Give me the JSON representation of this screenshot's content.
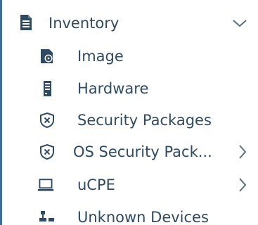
{
  "nav": {
    "header": {
      "label": "Inventory",
      "icon": "document-icon",
      "expanded": true
    },
    "items": [
      {
        "label": "Image",
        "icon": "disk-image-icon",
        "has_submenu": false
      },
      {
        "label": "Hardware",
        "icon": "server-tower-icon",
        "has_submenu": false
      },
      {
        "label": "Security Packages",
        "icon": "shield-x-icon",
        "has_submenu": false
      },
      {
        "label": "OS Security Pack...",
        "icon": "shield-x-icon",
        "has_submenu": true
      },
      {
        "label": "uCPE",
        "icon": "laptop-icon",
        "has_submenu": true
      },
      {
        "label": "Unknown Devices",
        "icon": "network-devices-icon",
        "has_submenu": false
      }
    ]
  },
  "colors": {
    "text": "#2f4a62",
    "accent_border": "#3c6e97",
    "icon": "#2f4a62",
    "chevron": "#5a6f82",
    "background": "#ffffff"
  }
}
